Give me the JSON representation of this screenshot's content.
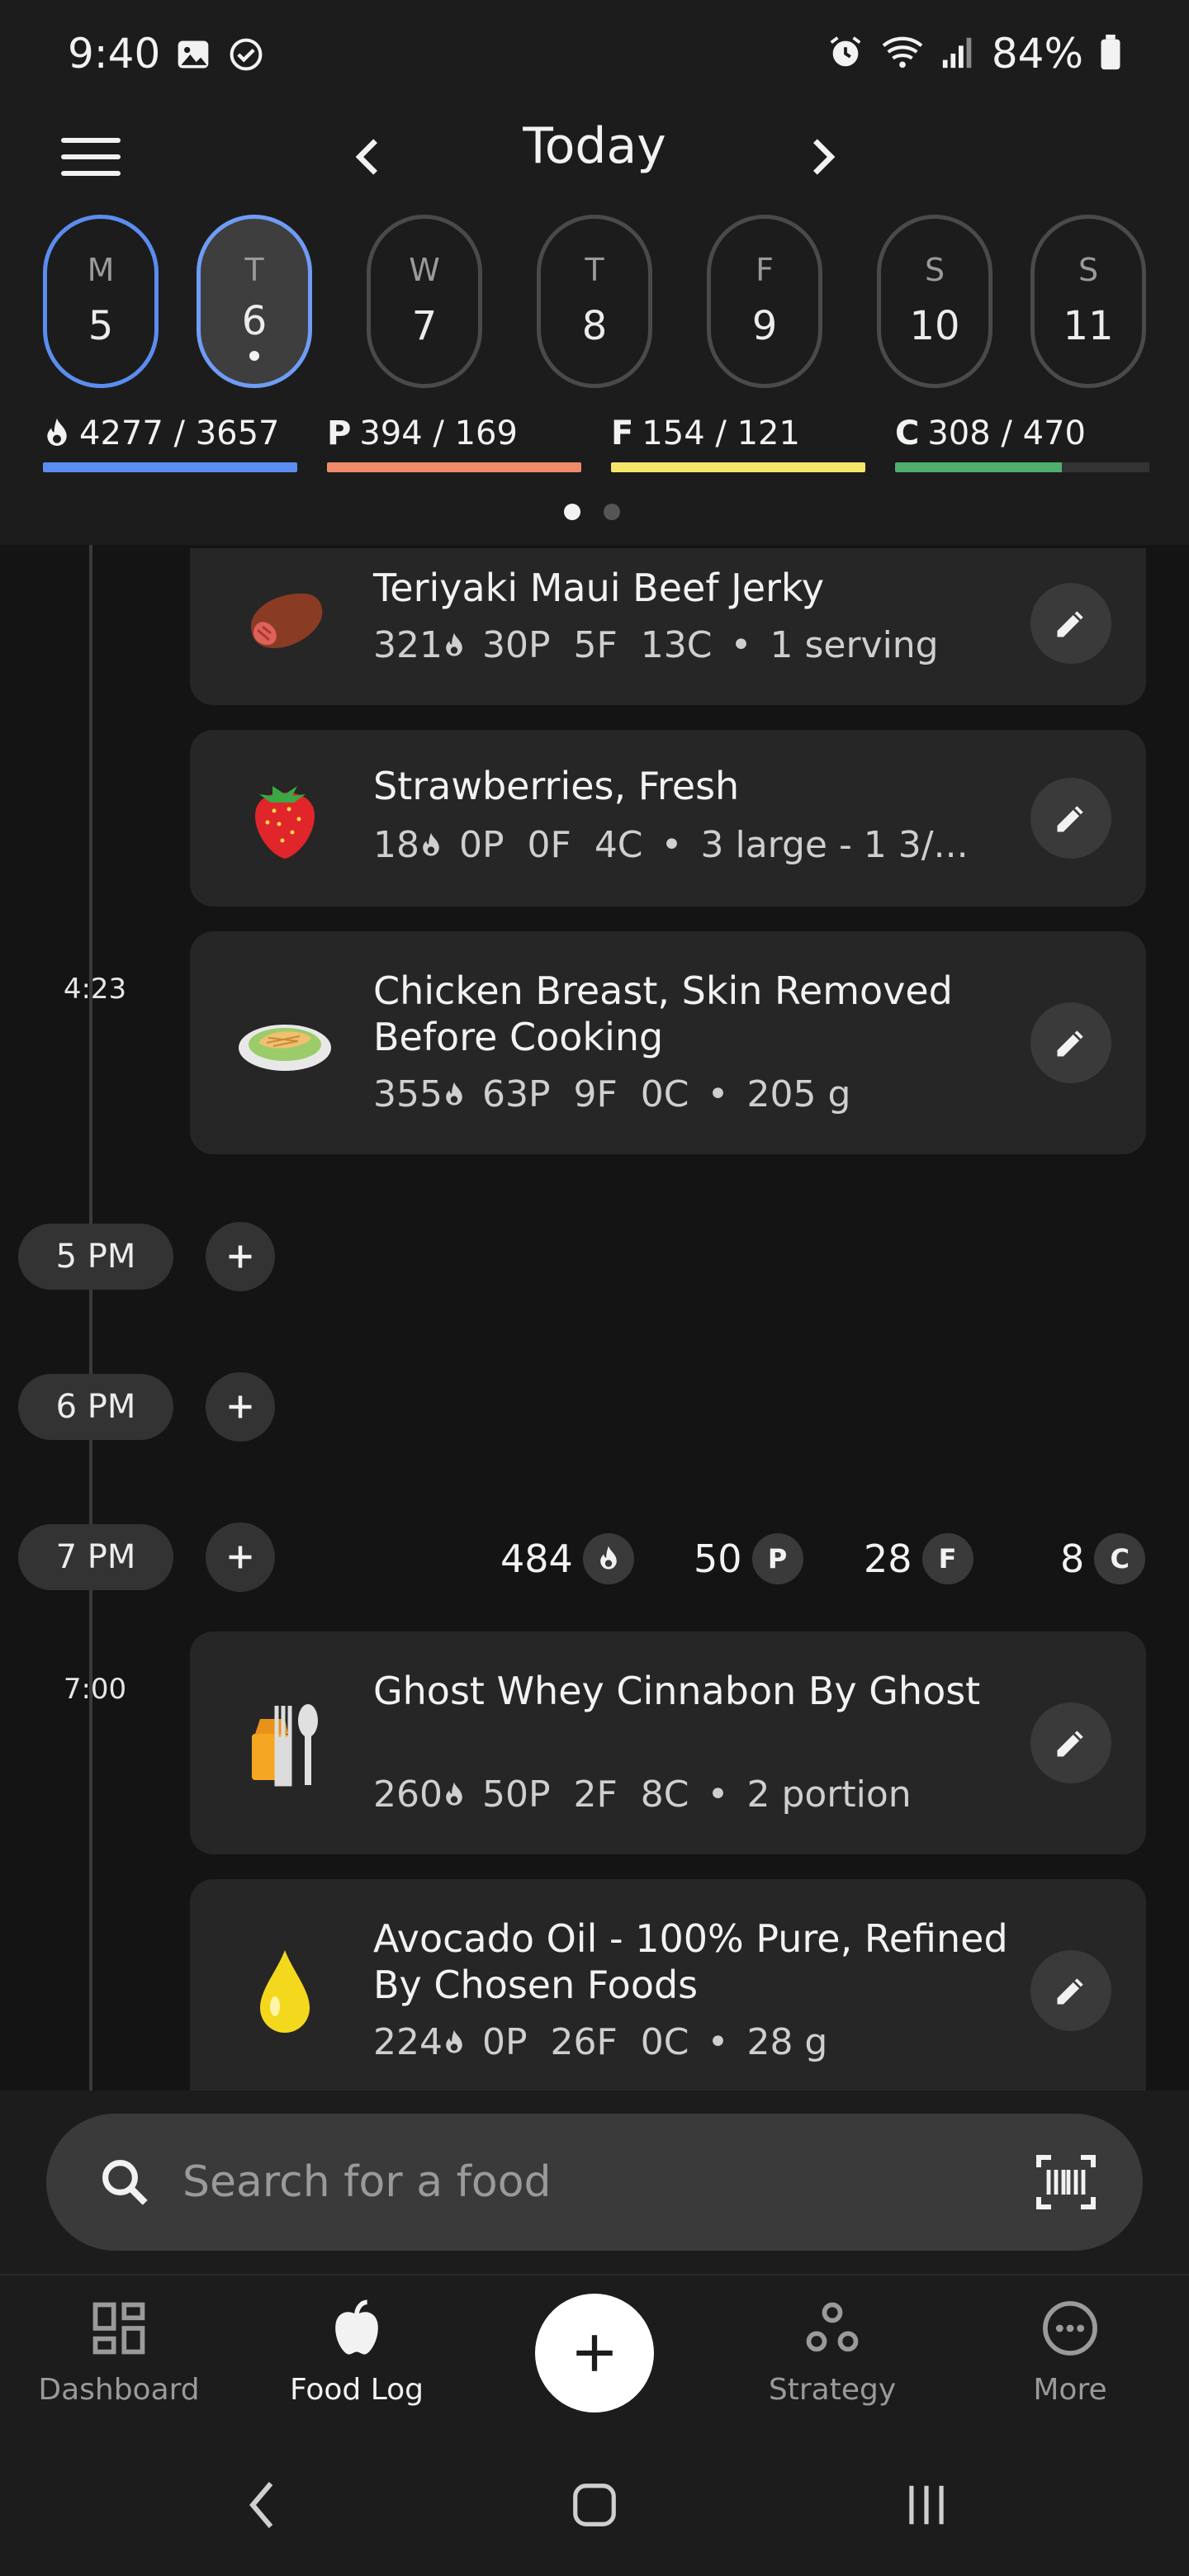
{
  "status_bar": {
    "time": "9:40",
    "battery": "84%"
  },
  "header": {
    "title": "Today"
  },
  "days": [
    {
      "letter": "M",
      "number": "5"
    },
    {
      "letter": "T",
      "number": "6"
    },
    {
      "letter": "W",
      "number": "7"
    },
    {
      "letter": "T",
      "number": "8"
    },
    {
      "letter": "F",
      "number": "9"
    },
    {
      "letter": "S",
      "number": "10"
    },
    {
      "letter": "S",
      "number": "11"
    }
  ],
  "macros": {
    "calories": {
      "text": "4277 / 3657",
      "color": "#5b8df0",
      "progress": 1.0
    },
    "protein": {
      "letter": "P",
      "text": "394 / 169",
      "color": "#f08a6a",
      "progress": 1.0
    },
    "fat": {
      "letter": "F",
      "text": "154 / 121",
      "color": "#f5e66a",
      "progress": 1.0
    },
    "carbs": {
      "letter": "C",
      "text": "308 / 470",
      "color": "#4fae6e",
      "progress": 0.655
    }
  },
  "foods": [
    {
      "name": "Teriyaki Maui Beef Jerky",
      "cal": "321",
      "p": "30P",
      "f": "5F",
      "c": "13C",
      "amount": "1 serving",
      "icon": "beef-jerky-icon"
    },
    {
      "name": "Strawberries, Fresh",
      "cal": "18",
      "p": "0P",
      "f": "0F",
      "c": "4C",
      "amount": "3 large - 1 3/...",
      "icon": "strawberry-icon"
    },
    {
      "name": "Chicken Breast, Skin Removed Before Cooking",
      "cal": "355",
      "p": "63P",
      "f": "9F",
      "c": "0C",
      "amount": "205 g",
      "icon": "chicken-plate-icon",
      "time": "4:23"
    },
    {
      "name": "Ghost Whey Cinnabon By Ghost",
      "cal": "260",
      "p": "50P",
      "f": "2F",
      "c": "8C",
      "amount": "2 portion",
      "icon": "utensils-icon",
      "time": "7:00"
    },
    {
      "name": "Avocado Oil - 100% Pure, Refined By Chosen Foods",
      "cal": "224",
      "p": "0P",
      "f": "26F",
      "c": "0C",
      "amount": "28 g",
      "icon": "oil-drop-icon"
    }
  ],
  "hours": [
    "5 PM",
    "6 PM",
    "7 PM"
  ],
  "summary_7pm": {
    "cal": "484",
    "protein": "50",
    "fat": "28",
    "carbs": "8",
    "p_badge": "P",
    "f_badge": "F",
    "c_badge": "C"
  },
  "search": {
    "placeholder": "Search for a food"
  },
  "nav": {
    "dashboard": "Dashboard",
    "food_log": "Food Log",
    "strategy": "Strategy",
    "more": "More"
  }
}
